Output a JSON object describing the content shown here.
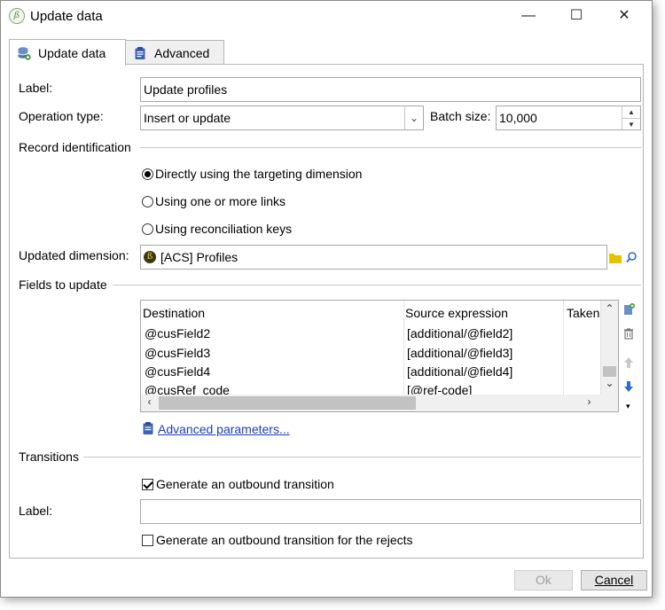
{
  "window": {
    "title": "Update data",
    "minimize_glyph": "—",
    "maximize_glyph": "☐",
    "close_glyph": "✕",
    "app_icon": "acs-logo-icon"
  },
  "tabs": [
    {
      "label": "Update data",
      "icon": "database-update-icon",
      "active": true
    },
    {
      "label": "Advanced",
      "icon": "clipboard-icon",
      "active": false
    }
  ],
  "form": {
    "label_caption": "Label:",
    "label_value": "Update profiles",
    "operation_type_caption": "Operation type:",
    "operation_type_value": "Insert or update",
    "batch_size_caption": "Batch size:",
    "batch_size_value": "10,000"
  },
  "record_identification": {
    "heading": "Record identification",
    "options": [
      {
        "label": "Directly using the targeting dimension",
        "checked": true
      },
      {
        "label": "Using one or more links",
        "checked": false
      },
      {
        "label": "Using reconciliation keys",
        "checked": false
      }
    ],
    "updated_dimension_caption": "Updated dimension:",
    "updated_dimension_value": "[ACS] Profiles"
  },
  "fields_to_update": {
    "heading": "Fields to update",
    "columns": [
      "Destination",
      "Source expression",
      "Taken"
    ],
    "rows": [
      {
        "destination": "@cusField2",
        "source": "[additional/@field2]"
      },
      {
        "destination": "@cusField3",
        "source": "[additional/@field3]"
      },
      {
        "destination": "@cusField4",
        "source": "[additional/@field4]"
      },
      {
        "destination": "@cusRef_code",
        "source": "[@ref-code]"
      }
    ],
    "advanced_link": "Advanced parameters..."
  },
  "transitions": {
    "heading": "Transitions",
    "generate_outbound_label": "Generate an outbound transition",
    "generate_outbound_checked": true,
    "label_caption": "Label:",
    "label_value": "",
    "generate_rejects_label": "Generate an outbound transition for the rejects",
    "generate_rejects_checked": false
  },
  "buttons": {
    "ok": "Ok",
    "cancel": "Cancel"
  },
  "colors": {
    "link": "#1a3ec0",
    "folder": "#e6c200",
    "arrow_blue": "#2a6cd0"
  }
}
